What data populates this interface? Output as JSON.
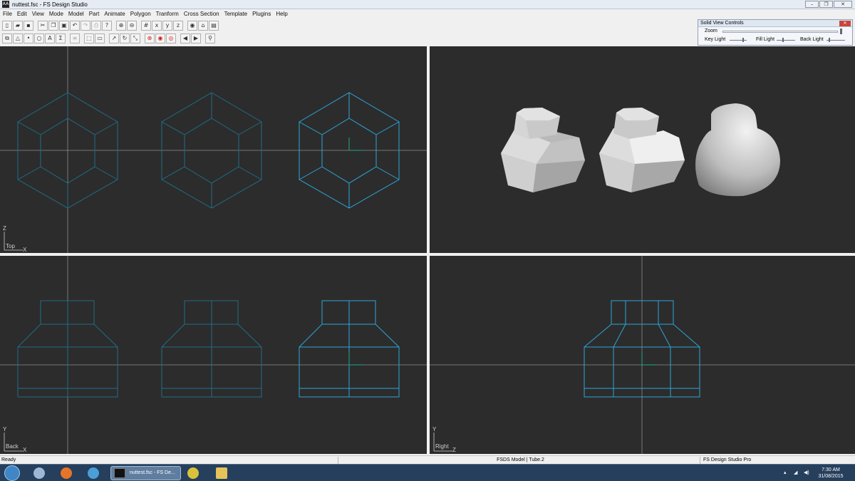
{
  "window": {
    "title": "nuttest.fsc - FS Design Studio",
    "app_icon": "AA"
  },
  "menu": [
    "File",
    "Edit",
    "View",
    "Mode",
    "Model",
    "Part",
    "Animate",
    "Polygon",
    "Tranform",
    "Cross Section",
    "Template",
    "Plugins",
    "Help"
  ],
  "solid_view_controls": {
    "title": "Solid View Controls",
    "zoom_label": "Zoom",
    "key_light_label": "Key Light",
    "fill_light_label": "Fill Light",
    "back_light_label": "Back Light"
  },
  "viewports": {
    "top": {
      "label": "Top",
      "h_axis": "X",
      "v_axis": "Z"
    },
    "back": {
      "label": "Back",
      "h_axis": "X",
      "v_axis": "Y"
    },
    "right": {
      "label": "Right",
      "h_axis": "Z",
      "v_axis": "Y"
    }
  },
  "status": {
    "left": "Ready",
    "middle": "FSDS Model | Tube.2",
    "right": "FS Design Studio Pro"
  },
  "taskbar": {
    "active_label": "nuttest.fsc - FS De...",
    "time": "7:30 AM",
    "date": "31/08/2015"
  },
  "colors": {
    "viewport_bg": "#2c2c2c",
    "wire": "#1f6d86",
    "wire_selected": "#2ba6d8",
    "crosshair": "#8c8c8c"
  }
}
